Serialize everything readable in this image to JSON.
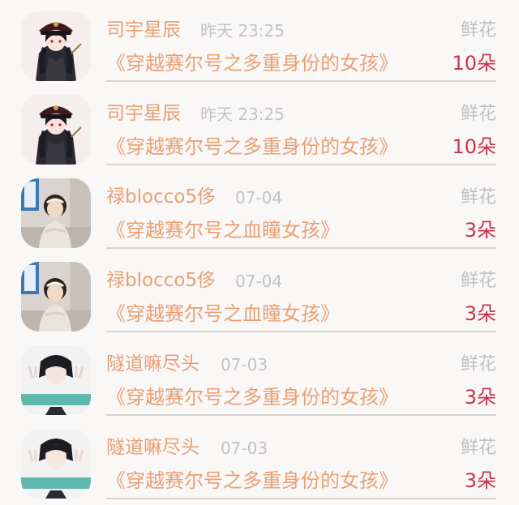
{
  "gifts": [
    {
      "avatar": "avatar-anime-officer",
      "name": "司宇星辰",
      "time": "昨天 23:25",
      "gift": "鲜花",
      "book": "《穿越赛尔号之多重身份的女孩》",
      "count": "10朵"
    },
    {
      "avatar": "avatar-anime-officer",
      "name": "司宇星辰",
      "time": "昨天 23:25",
      "gift": "鲜花",
      "book": "《穿越赛尔号之多重身份的女孩》",
      "count": "10朵"
    },
    {
      "avatar": "avatar-girl-photo",
      "name": "禄blocco5侈",
      "time": "07-04",
      "gift": "鲜花",
      "book": "《穿越赛尔号之血瞳女孩》",
      "count": "3朵"
    },
    {
      "avatar": "avatar-girl-photo",
      "name": "禄blocco5侈",
      "time": "07-04",
      "gift": "鲜花",
      "book": "《穿越赛尔号之血瞳女孩》",
      "count": "3朵"
    },
    {
      "avatar": "avatar-girl-peace-sign",
      "name": "隧道嘛尽头",
      "time": "07-03",
      "gift": "鲜花",
      "book": "《穿越赛尔号之多重身份的女孩》",
      "count": "3朵"
    },
    {
      "avatar": "avatar-girl-peace-sign",
      "name": "隧道嘛尽头",
      "time": "07-03",
      "gift": "鲜花",
      "book": "《穿越赛尔号之多重身份的女孩》",
      "count": "3朵"
    }
  ],
  "colors": {
    "name": "#e8a074",
    "time": "#c3c3c3",
    "gift": "#c0c0c0",
    "count": "#c8344a",
    "divider": "#d5d2d2",
    "background": "#faf7f7"
  }
}
